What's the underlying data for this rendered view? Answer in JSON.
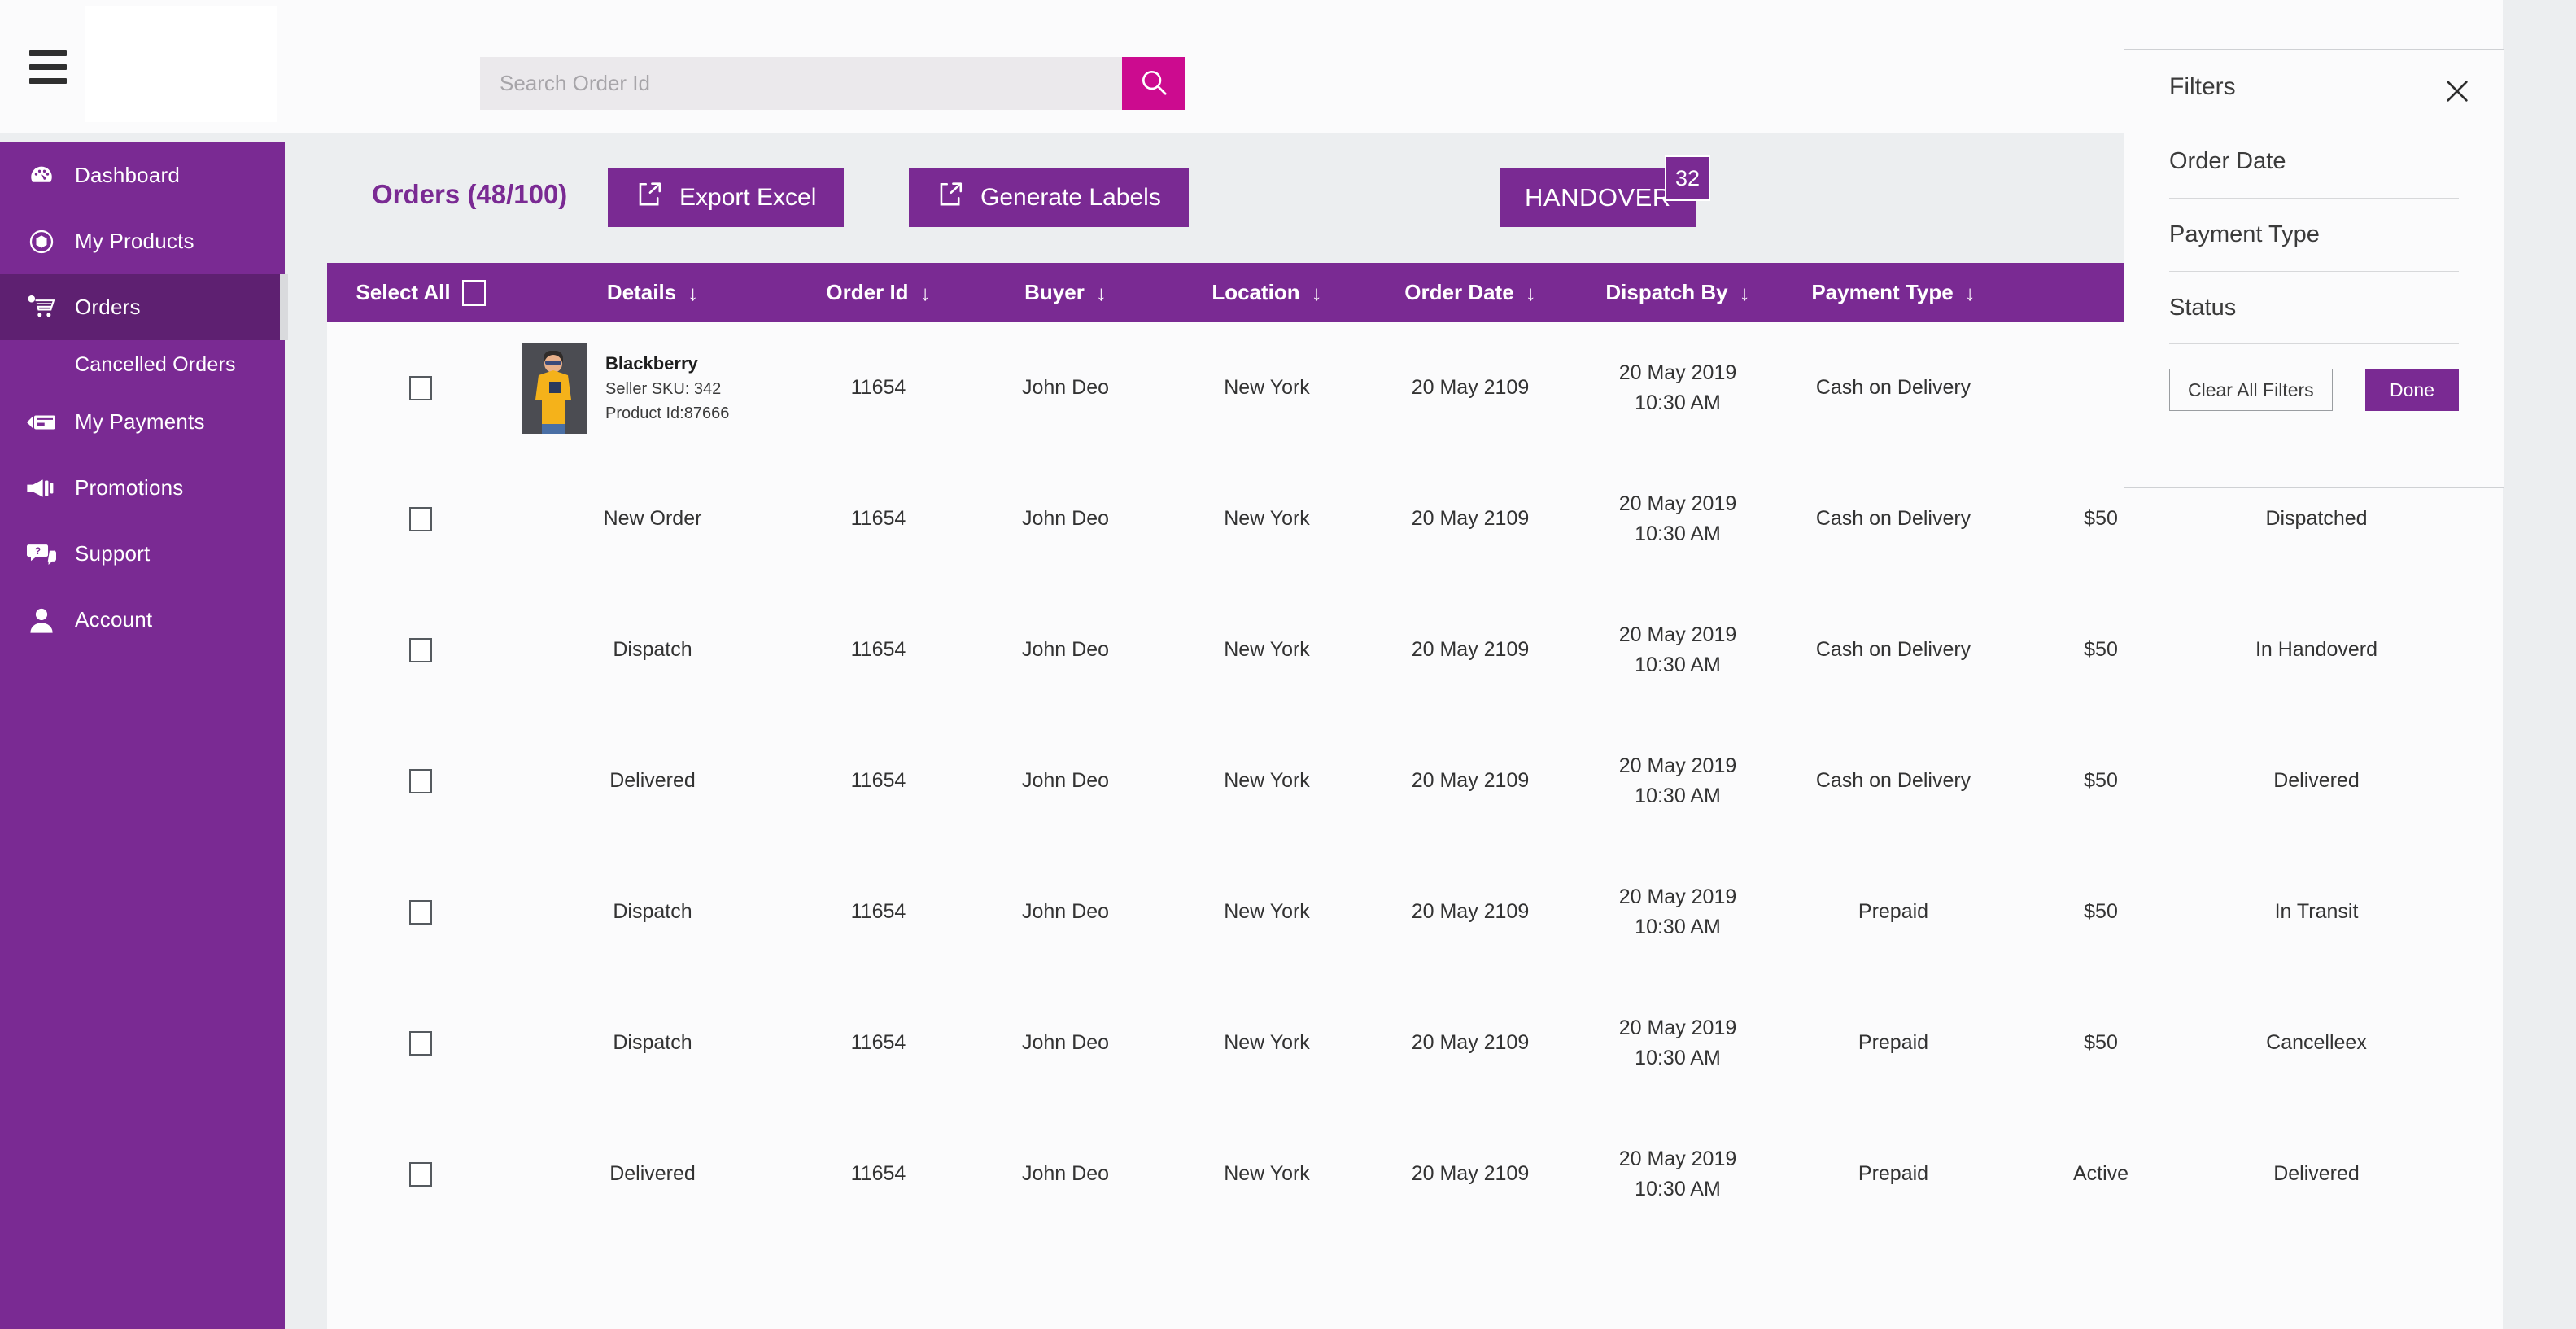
{
  "header": {
    "menu_icon": "hamburger-icon",
    "logo_alt": "logo-placeholder",
    "search": {
      "placeholder": "Search Order Id",
      "value": "",
      "button_icon": "search-icon"
    }
  },
  "sidebar": {
    "items": [
      {
        "label": "Dashboard",
        "icon": "dashboard-icon",
        "active": false,
        "sub": false
      },
      {
        "label": "My Products",
        "icon": "box-icon",
        "active": false,
        "sub": false
      },
      {
        "label": "Orders",
        "icon": "cart-icon",
        "active": true,
        "sub": false
      },
      {
        "label": "Cancelled Orders",
        "icon": "",
        "active": false,
        "sub": true
      },
      {
        "label": "My Payments",
        "icon": "credit-card-icon",
        "active": false,
        "sub": false
      },
      {
        "label": "Promotions",
        "icon": "megaphone-icon",
        "active": false,
        "sub": false
      },
      {
        "label": "Support",
        "icon": "chat-help-icon",
        "active": false,
        "sub": false
      },
      {
        "label": "Account",
        "icon": "user-icon",
        "active": false,
        "sub": false
      }
    ]
  },
  "toolbar": {
    "title": "Orders (48/100)",
    "export_label": "Export Excel",
    "export_icon": "export-icon",
    "labels_label": "Generate Labels",
    "labels_icon": "export-icon",
    "handover_label": "HANDOVER",
    "handover_count": "32"
  },
  "table": {
    "select_all_label": "Select All",
    "columns": [
      {
        "label": "Details",
        "sortable": true
      },
      {
        "label": "Order Id",
        "sortable": true
      },
      {
        "label": "Buyer",
        "sortable": true
      },
      {
        "label": "Location",
        "sortable": true
      },
      {
        "label": "Order Date",
        "sortable": true
      },
      {
        "label": "Dispatch By",
        "sortable": true
      },
      {
        "label": "Payment Type",
        "sortable": true
      }
    ],
    "rows": [
      {
        "details_type": "product",
        "product": {
          "name": "Blackberry",
          "seller_sku": "Seller SKU: 342",
          "product_id": "Product Id:87666"
        },
        "details": "",
        "order_id": "11654",
        "buyer": "John Deo",
        "location": "New York",
        "order_date": "20 May 2109",
        "dispatch_by": "20 May 2019\n10:30 AM",
        "payment_type": "Cash on Delivery",
        "amount": "",
        "status": ""
      },
      {
        "details_type": "text",
        "details": "New Order",
        "order_id": "11654",
        "buyer": "John Deo",
        "location": "New York",
        "order_date": "20 May 2109",
        "dispatch_by": "20 May 2019\n10:30 AM",
        "payment_type": "Cash on Delivery",
        "amount": "$50",
        "status": "Dispatched"
      },
      {
        "details_type": "text",
        "details": "Dispatch",
        "order_id": "11654",
        "buyer": "John Deo",
        "location": "New York",
        "order_date": "20 May 2109",
        "dispatch_by": "20 May 2019\n10:30 AM",
        "payment_type": "Cash on Delivery",
        "amount": "$50",
        "status": "In Handoverd"
      },
      {
        "details_type": "text",
        "details": "Delivered",
        "order_id": "11654",
        "buyer": "John Deo",
        "location": "New York",
        "order_date": "20 May 2109",
        "dispatch_by": "20 May 2019\n10:30 AM",
        "payment_type": "Cash on Delivery",
        "amount": "$50",
        "status": "Delivered"
      },
      {
        "details_type": "text",
        "details": "Dispatch",
        "order_id": "11654",
        "buyer": "John Deo",
        "location": "New York",
        "order_date": "20 May 2109",
        "dispatch_by": "20 May 2019\n10:30 AM",
        "payment_type": "Prepaid",
        "amount": "$50",
        "status": "In Transit"
      },
      {
        "details_type": "text",
        "details": "Dispatch",
        "order_id": "11654",
        "buyer": "John Deo",
        "location": "New York",
        "order_date": "20 May 2109",
        "dispatch_by": "20 May 2019\n10:30 AM",
        "payment_type": "Prepaid",
        "amount": "$50",
        "status": "Cancelleex"
      },
      {
        "details_type": "text",
        "details": "Delivered",
        "order_id": "11654",
        "buyer": "John Deo",
        "location": "New York",
        "order_date": "20 May 2109",
        "dispatch_by": "20 May 2019\n10:30 AM",
        "payment_type": "Prepaid",
        "amount": "Active",
        "status": "Delivered"
      }
    ]
  },
  "filters": {
    "title": "Filters",
    "close_icon": "close-icon",
    "rows": [
      {
        "label": "Order Date"
      },
      {
        "label": "Payment Type"
      },
      {
        "label": "Status"
      }
    ],
    "clear_label": "Clear All Filters",
    "done_label": "Done"
  },
  "colors": {
    "brand_purple": "#7a2a93",
    "brand_purple_dark": "#5e2071",
    "accent_magenta": "#cc0b8f",
    "page_bg": "#eceef0",
    "panel_bg": "#fbfbfc"
  }
}
